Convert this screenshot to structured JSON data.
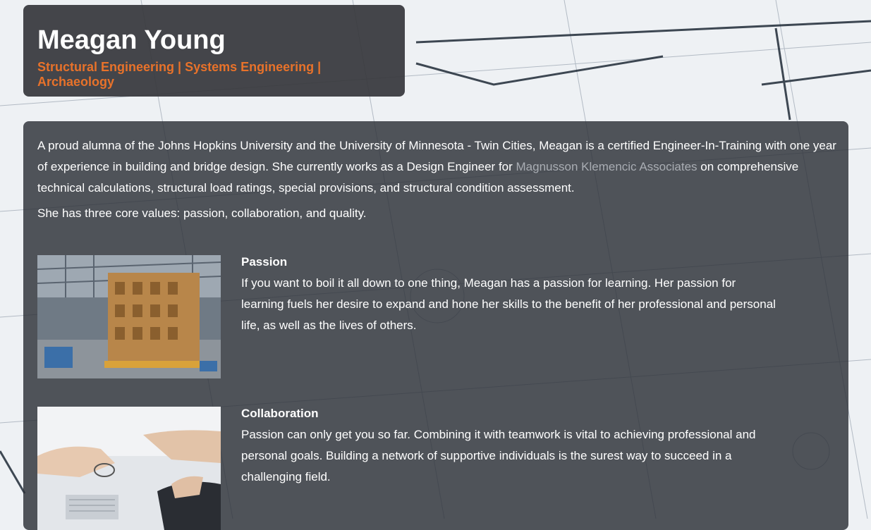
{
  "header": {
    "name": "Meagan Young",
    "subtitle": "Structural Engineering | Systems Engineering | Archaeology"
  },
  "intro": {
    "text_before": "A proud alumna of the Johns Hopkins University and the University of Minnesota - Twin Cities, Meagan is a certified Engineer-In-Training with one year of experience in building and bridge design. She currently works as a Design Engineer for ",
    "link_text": "Magnusson Klemencic Associates",
    "text_after": " on comprehensive technical calculations, structural load ratings, special provisions, and structural condition assessment.",
    "values_line": "She has three core values: passion, collaboration, and quality."
  },
  "features": [
    {
      "title": "Passion",
      "body": "If you want to boil it all down to one thing, Meagan has a passion for learning. Her passion for learning fuels her desire to expand and hone her skills to the benefit of her professional and personal life, as well as the lives of others."
    },
    {
      "title": "Collaboration",
      "body": "Passion can only get you so far. Combining it with teamwork is vital to achieving professional and personal goals. Building a network of supportive individuals is the surest way to succeed in a challenging field."
    }
  ],
  "colors": {
    "accent": "#e8722a",
    "link": "#a9adb3",
    "card": "#2c2f37"
  }
}
